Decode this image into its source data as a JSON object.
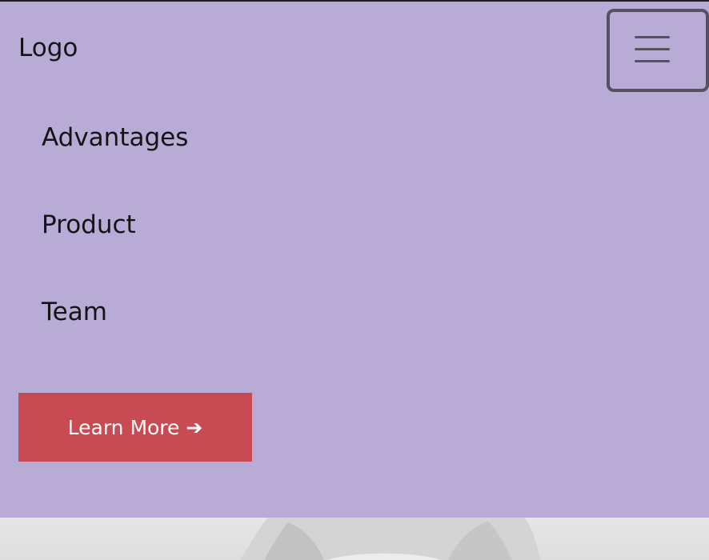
{
  "header": {
    "logo": "Logo",
    "menu_toggle_icon": "hamburger-menu-icon"
  },
  "nav": {
    "items": [
      {
        "label": "Advantages"
      },
      {
        "label": "Product"
      },
      {
        "label": "Team"
      }
    ]
  },
  "cta": {
    "label": "Learn More",
    "arrow": "➔"
  },
  "colors": {
    "navbar_bg": "#b8acd6",
    "cta_bg": "#c84a52",
    "toggler_border": "#55515f",
    "text": "#141414"
  }
}
